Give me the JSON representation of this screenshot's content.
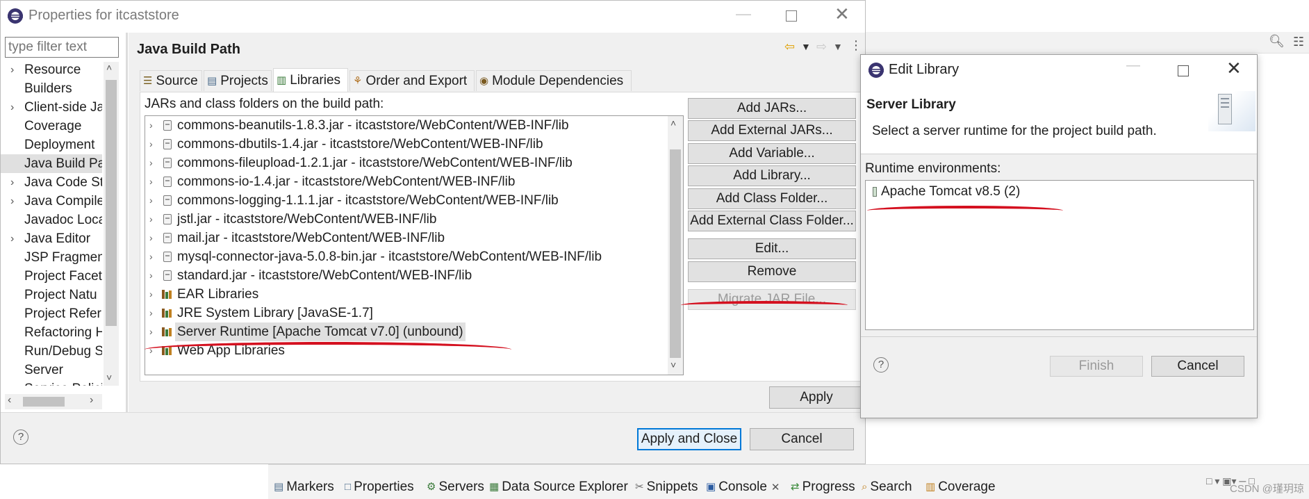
{
  "main_window": {
    "title": "Properties for itcaststore",
    "filter_placeholder": "type filter text",
    "page_title": "Java Build Path",
    "tabs": [
      {
        "label": "Source",
        "icon": "source-icon"
      },
      {
        "label": "Projects",
        "icon": "projects-icon"
      },
      {
        "label": "Libraries",
        "icon": "libraries-icon",
        "active": true
      },
      {
        "label": "Order and Export",
        "icon": "order-icon"
      },
      {
        "label": "Module Dependencies",
        "icon": "module-icon"
      }
    ],
    "build_path_label": "JARs and class folders on the build path:",
    "libraries": [
      {
        "label": "commons-beanutils-1.8.3.jar - itcaststore/WebContent/WEB-INF/lib",
        "kind": "jar"
      },
      {
        "label": "commons-dbutils-1.4.jar - itcaststore/WebContent/WEB-INF/lib",
        "kind": "jar"
      },
      {
        "label": "commons-fileupload-1.2.1.jar - itcaststore/WebContent/WEB-INF/lib",
        "kind": "jar"
      },
      {
        "label": "commons-io-1.4.jar - itcaststore/WebContent/WEB-INF/lib",
        "kind": "jar"
      },
      {
        "label": "commons-logging-1.1.1.jar - itcaststore/WebContent/WEB-INF/lib",
        "kind": "jar"
      },
      {
        "label": "jstl.jar - itcaststore/WebContent/WEB-INF/lib",
        "kind": "jar"
      },
      {
        "label": "mail.jar - itcaststore/WebContent/WEB-INF/lib",
        "kind": "jar"
      },
      {
        "label": "mysql-connector-java-5.0.8-bin.jar - itcaststore/WebContent/WEB-INF/lib",
        "kind": "jar"
      },
      {
        "label": "standard.jar - itcaststore/WebContent/WEB-INF/lib",
        "kind": "jar"
      },
      {
        "label": "EAR Libraries",
        "kind": "library"
      },
      {
        "label": "JRE System Library [JavaSE-1.7]",
        "kind": "library"
      },
      {
        "label": "Server Runtime [Apache Tomcat v7.0] (unbound)",
        "kind": "library",
        "selected": true
      },
      {
        "label": "Web App Libraries",
        "kind": "library"
      }
    ],
    "side_buttons": [
      {
        "label": "Add JARs...",
        "enabled": true
      },
      {
        "label": "Add External JARs...",
        "enabled": true
      },
      {
        "label": "Add Variable...",
        "enabled": true
      },
      {
        "label": "Add Library...",
        "enabled": true
      },
      {
        "label": "Add Class Folder...",
        "enabled": true
      },
      {
        "label": "Add External Class Folder...",
        "enabled": true
      },
      {
        "label": "Edit...",
        "enabled": true
      },
      {
        "label": "Remove",
        "enabled": true
      },
      {
        "label": "Migrate JAR File...",
        "enabled": false
      }
    ],
    "apply_label": "Apply",
    "apply_close_label": "Apply and Close",
    "cancel_label": "Cancel",
    "nav_items": [
      {
        "label": "Resource",
        "expandable": true
      },
      {
        "label": "Builders",
        "expandable": false
      },
      {
        "label": "Client-side Ja",
        "expandable": true
      },
      {
        "label": "Coverage",
        "expandable": false
      },
      {
        "label": "Deployment",
        "expandable": false
      },
      {
        "label": "Java Build Pa",
        "expandable": false,
        "selected": true
      },
      {
        "label": "Java Code Sty",
        "expandable": true
      },
      {
        "label": "Java Compile",
        "expandable": true
      },
      {
        "label": "Javadoc Loca",
        "expandable": false
      },
      {
        "label": "Java Editor",
        "expandable": true
      },
      {
        "label": "JSP Fragmen",
        "expandable": false
      },
      {
        "label": "Project Facet",
        "expandable": false
      },
      {
        "label": "Project Natu",
        "expandable": false
      },
      {
        "label": "Project Refer",
        "expandable": false
      },
      {
        "label": "Refactoring H",
        "expandable": false
      },
      {
        "label": "Run/Debug S",
        "expandable": false
      },
      {
        "label": "Server",
        "expandable": false
      },
      {
        "label": "Service Polici",
        "expandable": false
      }
    ]
  },
  "edit_library": {
    "title": "Edit Library",
    "section_title": "Server Library",
    "description": "Select a server runtime for the project build path.",
    "runtime_label": "Runtime environments:",
    "runtimes": [
      {
        "label": "Apache Tomcat v8.5 (2)"
      }
    ],
    "finish_label": "Finish",
    "cancel_label": "Cancel"
  },
  "bottom_tabs": [
    {
      "label": "Markers",
      "icon": "markers-icon"
    },
    {
      "label": "Properties",
      "icon": "properties-icon"
    },
    {
      "label": "Servers",
      "icon": "servers-icon"
    },
    {
      "label": "Data Source Explorer",
      "icon": "data-source-icon"
    },
    {
      "label": "Snippets",
      "icon": "snippets-icon"
    },
    {
      "label": "Console",
      "icon": "console-icon",
      "active": true
    },
    {
      "label": "Progress",
      "icon": "progress-icon"
    },
    {
      "label": "Search",
      "icon": "search-icon"
    },
    {
      "label": "Coverage",
      "icon": "coverage-icon"
    }
  ],
  "watermark": "CSDN @瑾玥琼",
  "colors": {
    "accent": "#0078d7",
    "selection": "#e0e0e0",
    "annotation": "#d4101f"
  }
}
